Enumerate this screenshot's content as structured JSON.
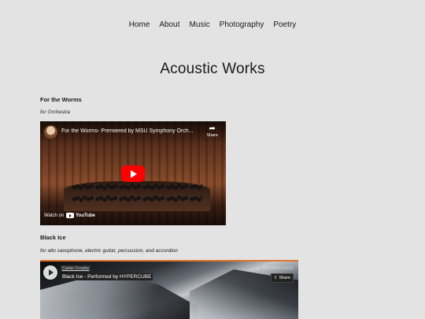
{
  "nav": {
    "items": [
      "Home",
      "About",
      "Music",
      "Photography",
      "Poetry"
    ]
  },
  "page": {
    "title": "Acoustic Works"
  },
  "works": [
    {
      "title": "For the Worms",
      "subtitle": "for Orchestra",
      "video": {
        "title": "For the Worms- Premiered by MSU Symphony Orch...",
        "share_label": "Share",
        "watch_on_label": "Watch on",
        "youtube_label": "YouTube"
      }
    },
    {
      "title": "Black Ice",
      "subtitle": "for alto saxophone, electric guitar, percussion, and accordion",
      "player": {
        "artist": "Carter Crosby",
        "track": "Black Ice - Performed by HYPERCUBE",
        "share_label": "Share",
        "logo_label": "SOUNDCLOUD"
      }
    }
  ],
  "colors": {
    "background": "#e3e3e3",
    "youtube_red": "#ff0000",
    "soundcloud_orange": "#e0752c"
  }
}
